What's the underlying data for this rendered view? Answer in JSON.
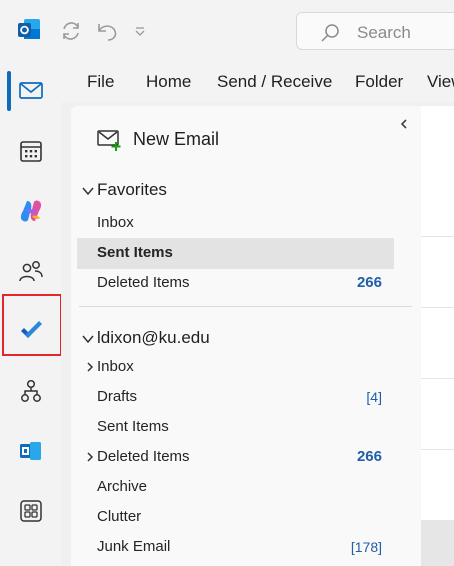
{
  "titlebar": {
    "app_icon": "outlook-logo-icon",
    "sync_icon": "sync-icon",
    "undo_icon": "undo-icon",
    "customize_icon": "chevron-down-icon"
  },
  "search": {
    "placeholder": "Search"
  },
  "ribbon": {
    "tabs": [
      "File",
      "Home",
      "Send / Receive",
      "Folder",
      "View"
    ]
  },
  "rail": {
    "items": [
      "mail-icon",
      "calendar-icon",
      "copilot-icon",
      "people-icon",
      "to-do-icon",
      "org-explorer-icon",
      "apps-icon",
      "more-apps-icon"
    ],
    "active_color": "#0f6cbd",
    "highlight_color": "#e4262b"
  },
  "folder_pane": {
    "new_email": "New Email",
    "favorites": {
      "header": "Favorites",
      "items": [
        {
          "label": "Inbox",
          "count": ""
        },
        {
          "label": "Sent Items",
          "count": ""
        },
        {
          "label": "Deleted Items",
          "count": "266"
        }
      ]
    },
    "account": {
      "header": "ldixon@ku.edu",
      "items": [
        {
          "label": "Inbox",
          "count": ""
        },
        {
          "label": "Drafts",
          "count": "[4]"
        },
        {
          "label": "Sent Items",
          "count": ""
        },
        {
          "label": "Deleted Items",
          "count": "266"
        },
        {
          "label": "Archive",
          "count": ""
        },
        {
          "label": "Clutter",
          "count": ""
        },
        {
          "label": "Junk Email",
          "count": "[178]"
        }
      ]
    }
  }
}
